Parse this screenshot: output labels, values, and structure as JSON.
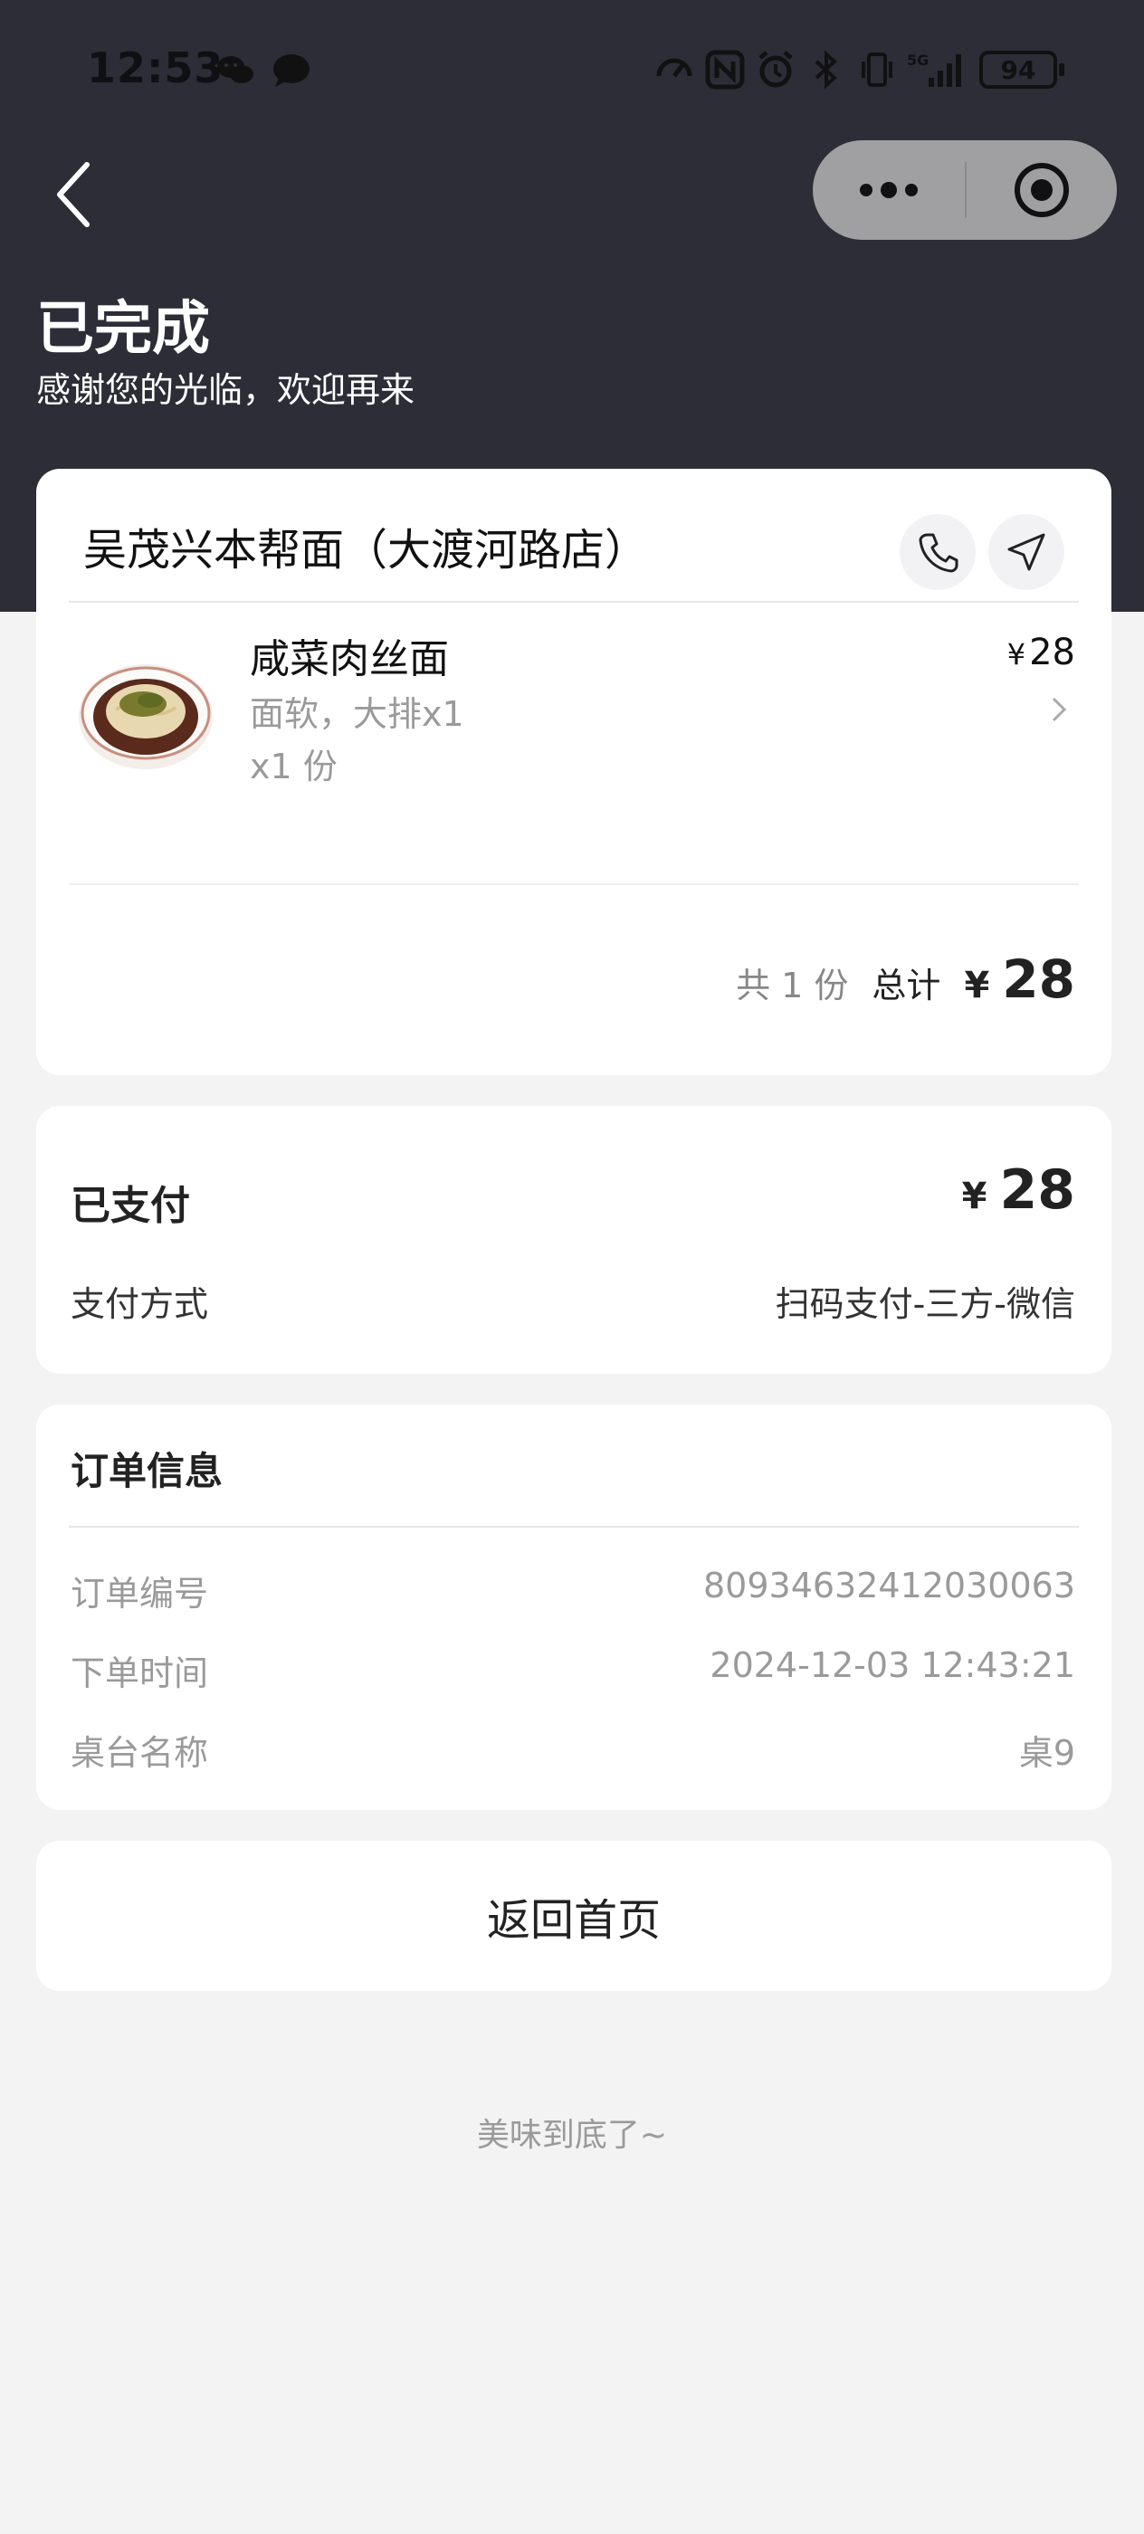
{
  "status_bar": {
    "time": "12:53",
    "battery": "94",
    "network": "5G"
  },
  "header": {
    "title": "已完成",
    "subtitle": "感谢您的光临，欢迎再来"
  },
  "store": {
    "name": "吴茂兴本帮面（大渡河路店）",
    "items": [
      {
        "name": "咸菜肉丝面",
        "spec": "面软，大排x1",
        "qty": "x1 份",
        "currency": "¥",
        "price": "28"
      }
    ],
    "total_count": "共 1 份",
    "total_label": "总计",
    "currency": "¥",
    "total_amount": "28"
  },
  "payment": {
    "status": "已支付",
    "currency": "¥",
    "amount": "28",
    "method_label": "支付方式",
    "method_value": "扫码支付-三方-微信"
  },
  "order_info": {
    "title": "订单信息",
    "rows": [
      {
        "label": "订单编号",
        "value": "80934632412030063"
      },
      {
        "label": "下单时间",
        "value": "2024-12-03 12:43:21"
      },
      {
        "label": "桌台名称",
        "value": "桌9"
      }
    ]
  },
  "home_button": "返回首页",
  "footer": "美味到底了~",
  "colors": {
    "header_bg": "#2c2d37",
    "page_bg": "#f3f3f3",
    "card_bg": "#ffffff",
    "muted_text": "#9a9a9a"
  }
}
